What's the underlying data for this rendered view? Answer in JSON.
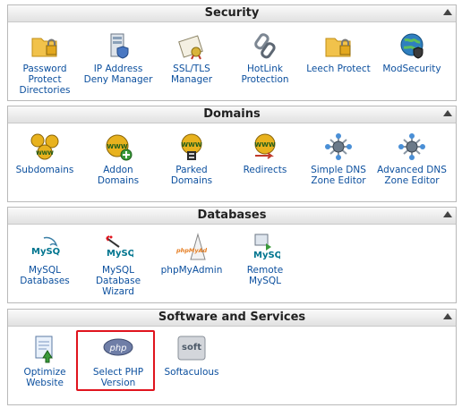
{
  "sections": [
    {
      "title": "Security",
      "items": [
        {
          "label": "Password Protect Directories",
          "icon": "folder-lock-icon"
        },
        {
          "label": "IP Address Deny Manager",
          "icon": "server-shield-icon"
        },
        {
          "label": "SSL/TLS Manager",
          "icon": "certificate-icon"
        },
        {
          "label": "HotLink Protection",
          "icon": "chain-link-icon"
        },
        {
          "label": "Leech Protect",
          "icon": "folder-lock-icon"
        },
        {
          "label": "ModSecurity",
          "icon": "globe-shield-icon"
        }
      ]
    },
    {
      "title": "Domains",
      "items": [
        {
          "label": "Subdomains",
          "icon": "www-globes-icon"
        },
        {
          "label": "Addon Domains",
          "icon": "www-add-icon"
        },
        {
          "label": "Parked Domains",
          "icon": "www-parked-icon"
        },
        {
          "label": "Redirects",
          "icon": "www-redirect-icon"
        },
        {
          "label": "Simple DNS Zone Editor",
          "icon": "dns-network-icon"
        },
        {
          "label": "Advanced DNS Zone Editor",
          "icon": "dns-network-icon"
        }
      ]
    },
    {
      "title": "Databases",
      "items": [
        {
          "label": "MySQL Databases",
          "icon": "mysql-dolphin-icon",
          "logo_text": "MySQL"
        },
        {
          "label": "MySQL Database Wizard",
          "icon": "mysql-wizard-icon",
          "logo_text": "MySQL"
        },
        {
          "label": "phpMyAdmin",
          "icon": "phpmyadmin-icon",
          "logo_text": "phpMyAdmin"
        },
        {
          "label": "Remote MySQL",
          "icon": "remote-mysql-icon",
          "logo_text": "MySQL"
        }
      ]
    },
    {
      "title": "Software and Services",
      "items": [
        {
          "label": "Optimize Website",
          "icon": "optimize-document-icon"
        },
        {
          "label": "Select PHP Version",
          "icon": "php-logo-icon",
          "logo_text": "php",
          "highlighted": true
        },
        {
          "label": "Softaculous",
          "icon": "softaculous-logo-icon",
          "logo_text": "soft"
        }
      ]
    }
  ],
  "colors": {
    "link": "#0b4f9e",
    "highlight": "#e0141e",
    "panel_border": "#b9b9b9"
  }
}
